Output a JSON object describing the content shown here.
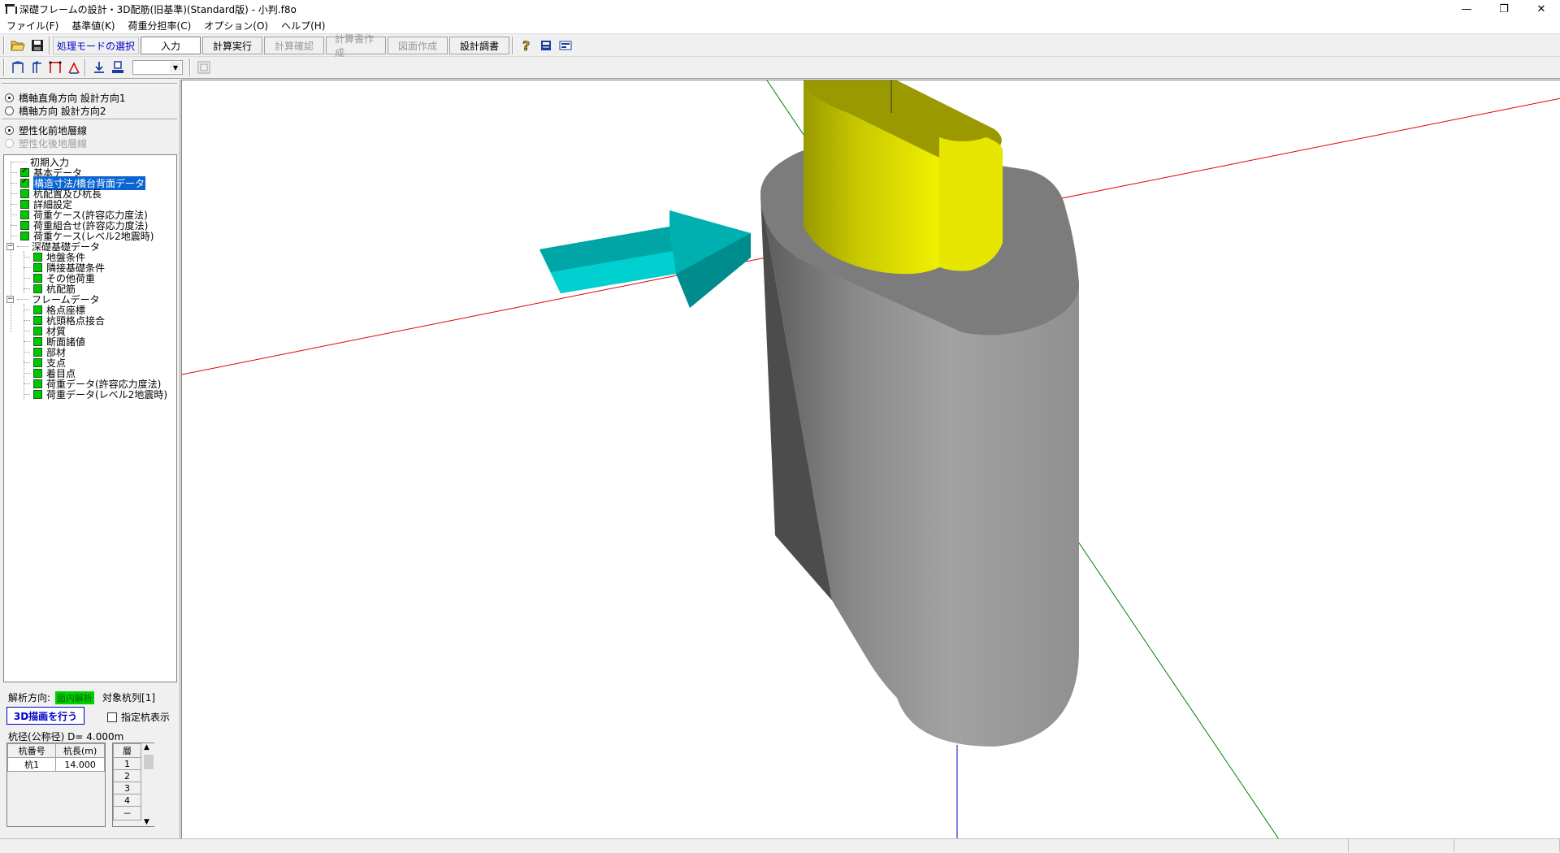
{
  "window": {
    "title": "深礎フレームの設計・3D配筋(旧基準)(Standard版) - 小判.f8o",
    "minimize": "—",
    "restore": "❐",
    "close": "✕"
  },
  "menu": [
    "ファイル(F)",
    "基準値(K)",
    "荷重分担率(C)",
    "オプション(O)",
    "ヘルプ(H)"
  ],
  "toolbar": {
    "mode_label": "処理モードの選択",
    "buttons": [
      {
        "label": "入力",
        "state": "active"
      },
      {
        "label": "計算実行",
        "state": "normal"
      },
      {
        "label": "計算確認",
        "state": "disabled"
      },
      {
        "label": "計算書作成",
        "state": "disabled"
      },
      {
        "label": "図面作成",
        "state": "disabled"
      },
      {
        "label": "設計調書",
        "state": "normal"
      }
    ],
    "help_icon": "question-icon"
  },
  "direction_radios": [
    {
      "label": "橋軸直角方向 設計方向1",
      "checked": true
    },
    {
      "label": "橋軸方向 設計方向2",
      "checked": false
    }
  ],
  "strata_radios": [
    {
      "label": "塑性化前地層線",
      "checked": true,
      "disabled": false
    },
    {
      "label": "塑性化後地層線",
      "checked": false,
      "disabled": true
    }
  ],
  "tree": [
    {
      "label": "初期入力",
      "level": 0,
      "type": "plain"
    },
    {
      "label": "基本データ",
      "level": 0,
      "type": "check"
    },
    {
      "label": "構造寸法/橋台背面データ",
      "level": 0,
      "type": "check",
      "selected": true
    },
    {
      "label": "杭配置及び杭長",
      "level": 0,
      "type": "box"
    },
    {
      "label": "詳細設定",
      "level": 0,
      "type": "box"
    },
    {
      "label": "荷重ケース(許容応力度法)",
      "level": 0,
      "type": "box"
    },
    {
      "label": "荷重組合せ(許容応力度法)",
      "level": 0,
      "type": "box"
    },
    {
      "label": "荷重ケース(レベル2地震時)",
      "level": 0,
      "type": "box"
    },
    {
      "label": "深礎基礎データ",
      "level": 0,
      "type": "group"
    },
    {
      "label": "地盤条件",
      "level": 1,
      "type": "box"
    },
    {
      "label": "隣接基礎条件",
      "level": 1,
      "type": "box"
    },
    {
      "label": "その他荷重",
      "level": 1,
      "type": "box"
    },
    {
      "label": "杭配筋",
      "level": 1,
      "type": "box"
    },
    {
      "label": "フレームデータ",
      "level": 0,
      "type": "group"
    },
    {
      "label": "格点座標",
      "level": 1,
      "type": "box"
    },
    {
      "label": "杭頭格点接合",
      "level": 1,
      "type": "box"
    },
    {
      "label": "材質",
      "level": 1,
      "type": "box"
    },
    {
      "label": "断面諸値",
      "level": 1,
      "type": "box"
    },
    {
      "label": "部材",
      "level": 1,
      "type": "box"
    },
    {
      "label": "支点",
      "level": 1,
      "type": "box"
    },
    {
      "label": "着目点",
      "level": 1,
      "type": "box"
    },
    {
      "label": "荷重データ(許容応力度法)",
      "level": 1,
      "type": "box"
    },
    {
      "label": "荷重データ(レベル2地震時)",
      "level": 1,
      "type": "box"
    }
  ],
  "analysis": {
    "label": "解析方向:",
    "badge": "面内解析",
    "target": "対象杭列[1]",
    "draw_button": "3D描画を行う",
    "show_pile_label": "指定杭表示",
    "diameter": "杭径(公称径) D= 4.000m"
  },
  "pile_table": {
    "headers": [
      "杭番号",
      "杭長(m)"
    ],
    "rows": [
      [
        "杭1",
        "14.000"
      ]
    ]
  },
  "layer_table": {
    "header": "層",
    "rows": [
      "1",
      "2",
      "3",
      "4",
      "－"
    ]
  },
  "colors": {
    "selection": "#0a64d2",
    "complete_box": "#00c800",
    "arrow": "#00c8c8",
    "pier_top": "#e0e000",
    "pile_body": "#8a8a8a",
    "axis_x": "#e00000",
    "axis_y": "#008000",
    "axis_z": "#0000c8"
  }
}
